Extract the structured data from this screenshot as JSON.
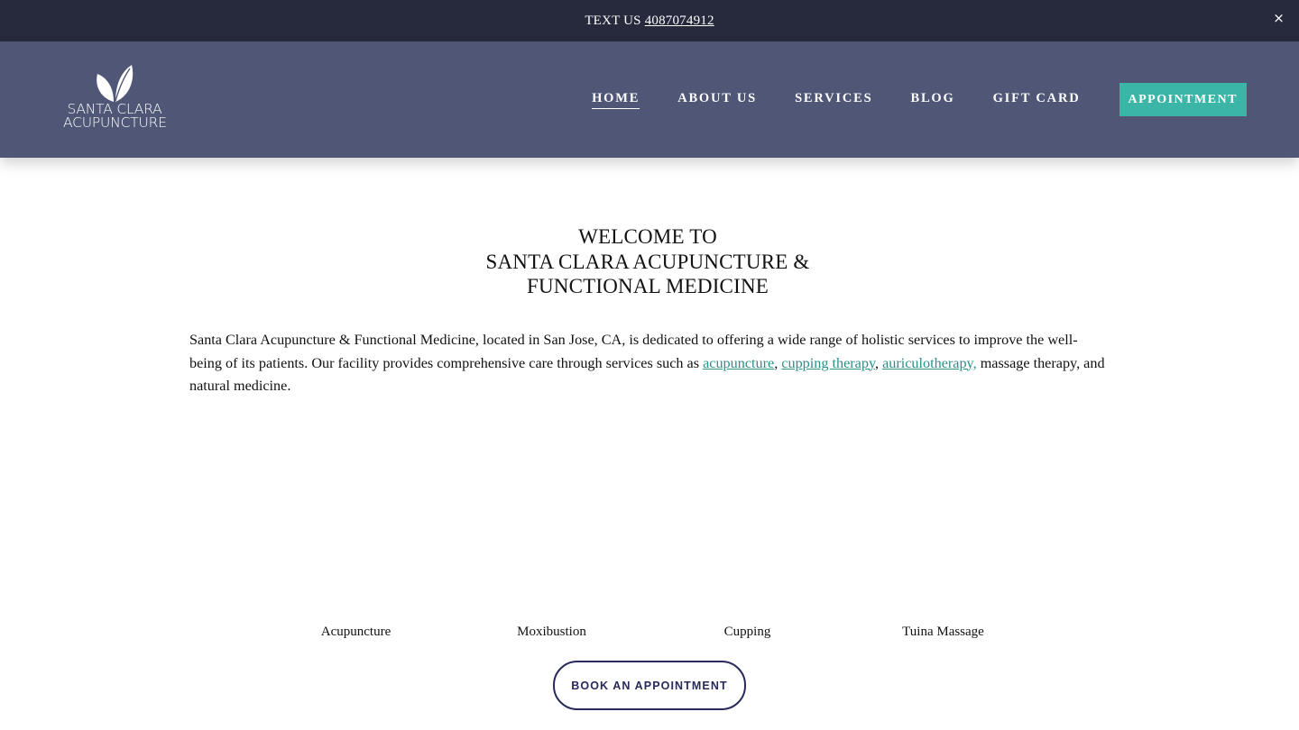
{
  "announcement": {
    "text": "TEXT US",
    "phone": "4087074912",
    "close_label": "×"
  },
  "brand": {
    "line1": "SANTA CLARA",
    "line2": "ACUPUNCTURE",
    "icon": "leaf-icon"
  },
  "nav": {
    "items": [
      {
        "label": "HOME",
        "active": true
      },
      {
        "label": "ABOUT US"
      },
      {
        "label": "SERVICES"
      },
      {
        "label": "BLOG"
      },
      {
        "label": "GIFT CARD"
      }
    ],
    "cta": "APPOINTMENT"
  },
  "welcome": {
    "line1": "WELCOME TO",
    "line2": "SANTA CLARA ACUPUNCTURE &",
    "line3": "FUNCTIONAL MEDICINE"
  },
  "intro": {
    "text_before": "Santa Clara Acupuncture & Functional Medicine, located in San Jose, CA, is dedicated to offering a wide range of holistic services to improve the well-being of its patients. Our facility provides comprehensive care through services such as ",
    "link1": "acupuncture",
    "sep1": ", ",
    "link2": "cupping therapy",
    "sep2": ", ",
    "link3": "auriculotherapy,",
    "text_after": " massage therapy, and natural medicine."
  },
  "services": [
    "Acupuncture",
    "Moxibustion",
    "Cupping",
    "Tuina Massage"
  ],
  "book_button": "BOOK AN APPOINTMENT",
  "colors": {
    "announcement_bg": "#272a3d",
    "header_bg": "#4f5676",
    "accent": "#3ab5a6",
    "link": "#2a8f87",
    "button_border": "#272a5a"
  }
}
